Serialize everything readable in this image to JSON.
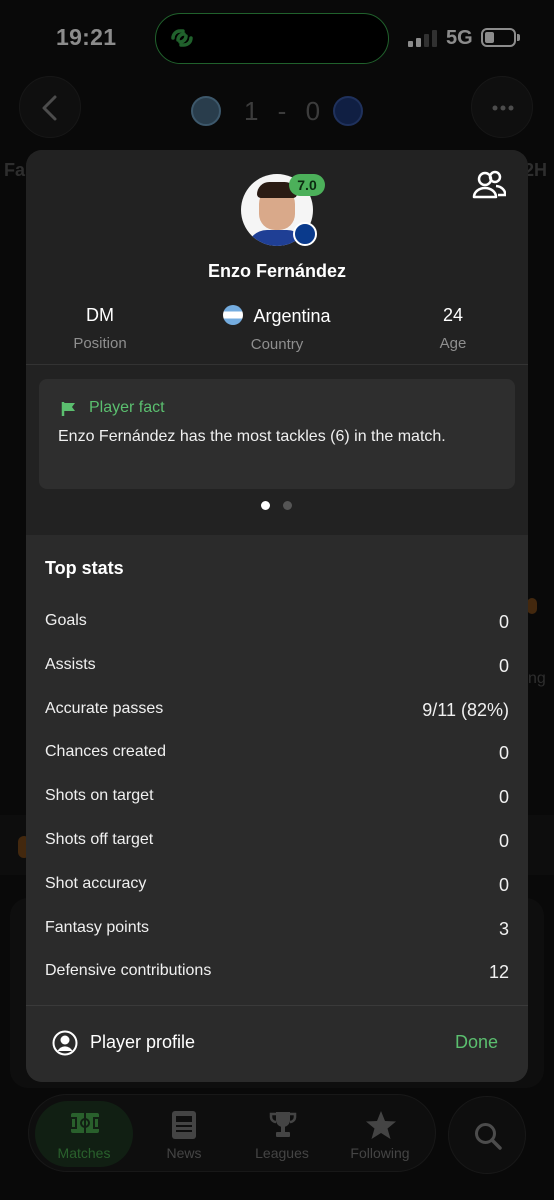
{
  "status_bar": {
    "time": "19:21",
    "network": "5G",
    "signal_bars": 4,
    "signal_bars_active": 2,
    "battery_level": 0.2
  },
  "header": {
    "score": "1 - 0",
    "home_crest": "man-city-crest-icon",
    "away_crest": "chelsea-crest-icon",
    "background_tab_left": "Fa",
    "background_tab_right": "2H",
    "background_text_right": "ng"
  },
  "player_card": {
    "rating": "7.0",
    "rating_color": "#4cb05a",
    "name": "Enzo Fernández",
    "info": [
      {
        "value": "DM",
        "label": "Position"
      },
      {
        "value": "Argentina",
        "label": "Country"
      },
      {
        "value": "24",
        "label": "Age"
      }
    ],
    "fact": {
      "title": "Player fact",
      "text": "Enzo Fernández has the most tackles (6) in the match."
    },
    "pager": {
      "pages": 2,
      "active": 1
    },
    "top_stats": {
      "title": "Top stats",
      "rows": [
        {
          "name": "Goals",
          "value": "0"
        },
        {
          "name": "Assists",
          "value": "0"
        },
        {
          "name": "Accurate passes",
          "value": "9/11 (82%)"
        },
        {
          "name": "Chances created",
          "value": "0"
        },
        {
          "name": "Shots on target",
          "value": "0"
        },
        {
          "name": "Shots off target",
          "value": "0"
        },
        {
          "name": "Shot accuracy",
          "value": "0"
        },
        {
          "name": "Fantasy points",
          "value": "3"
        },
        {
          "name": "Defensive contributions",
          "value": "12"
        }
      ]
    },
    "footer": {
      "profile_label": "Player profile",
      "done_label": "Done"
    },
    "accent_color": "#5bbf6f"
  },
  "bottom_nav": {
    "items": [
      {
        "label": "Matches",
        "icon": "pitch-icon",
        "active": true
      },
      {
        "label": "News",
        "icon": "news-icon",
        "active": false
      },
      {
        "label": "Leagues",
        "icon": "trophy-icon",
        "active": false
      },
      {
        "label": "Following",
        "icon": "star-icon",
        "active": false
      }
    ],
    "search_icon": "search-icon"
  }
}
